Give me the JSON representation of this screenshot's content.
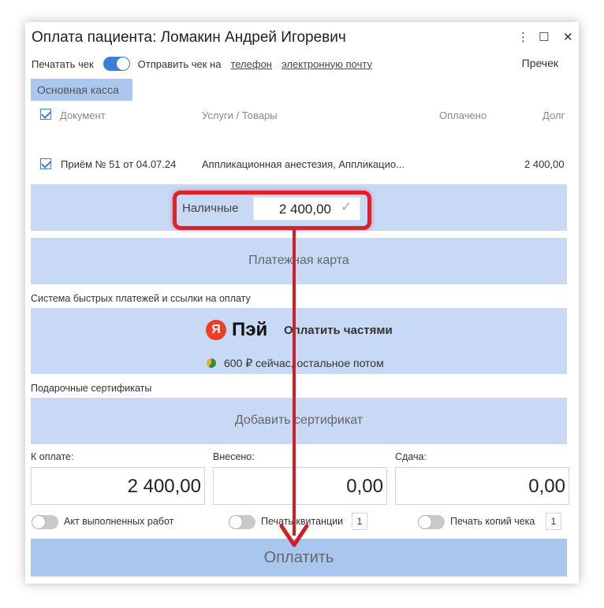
{
  "window": {
    "title": "Оплата пациента: Ломакин Андрей Игоревич",
    "controls": {
      "menu": "⋮",
      "maximize": "☐",
      "close": "✕"
    }
  },
  "options": {
    "print_receipt_label": "Печатать чек",
    "send_receipt_label": "Отправить чек на",
    "phone_link": "телефон",
    "email_link": "электронную почту",
    "precheck_label": "Пречек"
  },
  "kassa_tab": "Основная касса",
  "table": {
    "headers": {
      "document": "Документ",
      "services": "Услуги / Товары",
      "paid": "Оплачено",
      "debt": "Долг"
    },
    "rows": [
      {
        "document": "Приём № 51 от 04.07.24",
        "services": "Аппликационная анестезия, Аппликацио...",
        "paid": "",
        "debt": "2 400,00",
        "checked": true
      }
    ]
  },
  "cash": {
    "label": "Наличные",
    "value": "2 400,00",
    "confirm_icon": "✓"
  },
  "card_button": "Платежная карта",
  "fast_payments": {
    "section_label": "Система быстрых платежей и ссылки на оплату",
    "yandex_letter": "Я",
    "yandex_pay": "Пэй",
    "pay_in_parts": "Оплатить частями",
    "split_note": "600 ₽ сейчас, остальное потом"
  },
  "certificates": {
    "section_label": "Подарочные сертификаты",
    "add_button": "Добавить сертификат"
  },
  "totals": {
    "to_pay_label": "К оплате:",
    "to_pay_value": "2 400,00",
    "deposited_label": "Внесено:",
    "deposited_value": "0,00",
    "change_label": "Сдача:",
    "change_value": "0,00"
  },
  "print_options": {
    "act_label": "Акт выполненных работ",
    "receipt_print_label": "Печать квитанции",
    "receipt_print_count": "1",
    "copies_label": "Печать копий чека",
    "copies_count": "1"
  },
  "pay_button": "Оплатить",
  "colors": {
    "accent": "#3d7ed6",
    "band": "#c8d9f5",
    "highlight": "#e0202a",
    "pay_button": "#a9c7ee"
  }
}
